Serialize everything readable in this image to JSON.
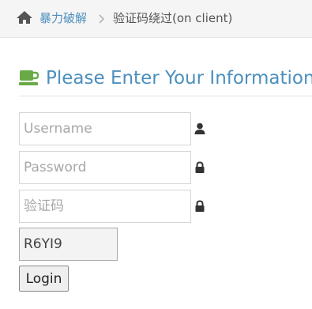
{
  "breadcrumb": {
    "home_icon": "home-icon",
    "link_label": "暴力破解",
    "separator_icon": "chevron-right-icon",
    "current_label": "验证码绕过(on client)"
  },
  "header": {
    "icon": "coffee-icon",
    "title": "Please Enter Your Information"
  },
  "form": {
    "username": {
      "value": "",
      "placeholder": "Username",
      "icon": "user-icon"
    },
    "password": {
      "value": "",
      "placeholder": "Password",
      "icon": "lock-icon"
    },
    "captcha": {
      "value": "",
      "placeholder": "验证码",
      "icon": "lock-icon"
    },
    "captcha_code": "R6YI9",
    "login_label": "Login"
  },
  "colors": {
    "accent": "#4c8fbd",
    "icon_green": "#69aa46",
    "breadcrumb_bg": "#f5f5f5"
  }
}
